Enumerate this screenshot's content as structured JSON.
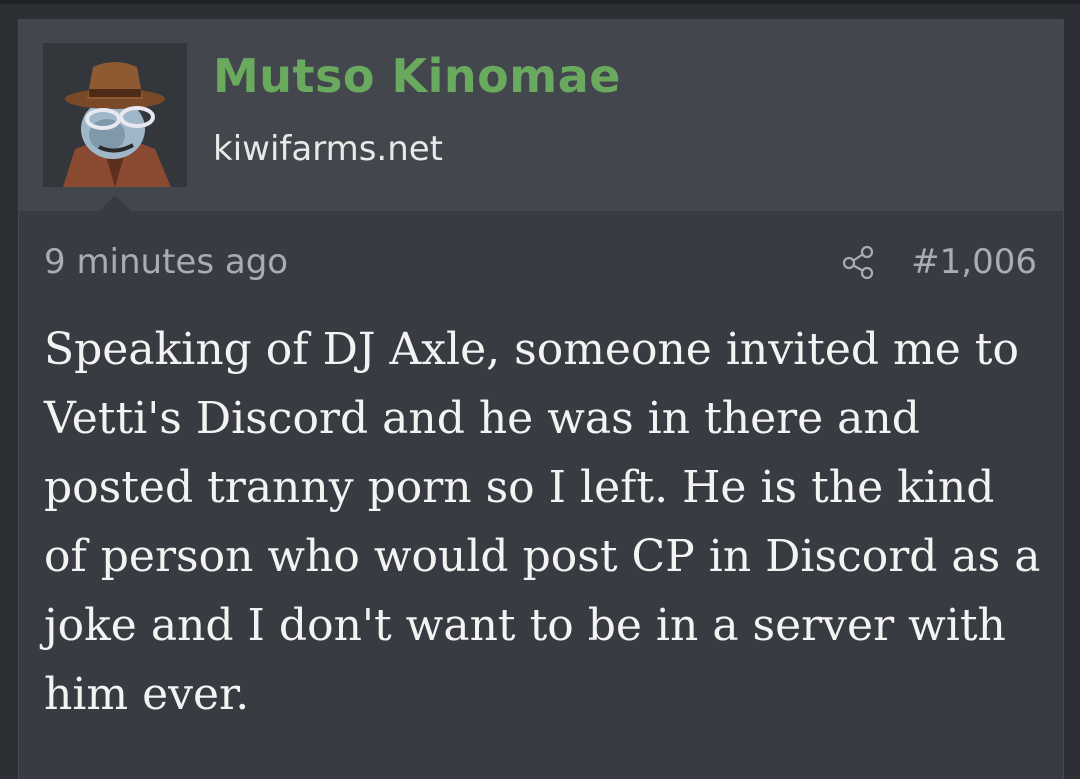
{
  "post": {
    "author": {
      "name": "Mutso Kinomae",
      "title": "kiwifarms.net",
      "avatar_icon": "detective-avatar-icon"
    },
    "time": "9 minutes ago",
    "share_icon": "share-icon",
    "number": "#1,006",
    "message": "Speaking of DJ Axle, someone invited me to Vetti's Discord and he was in there and posted tranny porn so I left. He is the kind of person who would post CP in Discord as a joke and I don't want to be in a server with him ever."
  },
  "colors": {
    "background": "#2c2f34",
    "post_body": "#383b42",
    "user_block": "#43474d",
    "username": "#6aaa5f",
    "meta": "#a9acb1",
    "text": "#f3f3f3"
  }
}
